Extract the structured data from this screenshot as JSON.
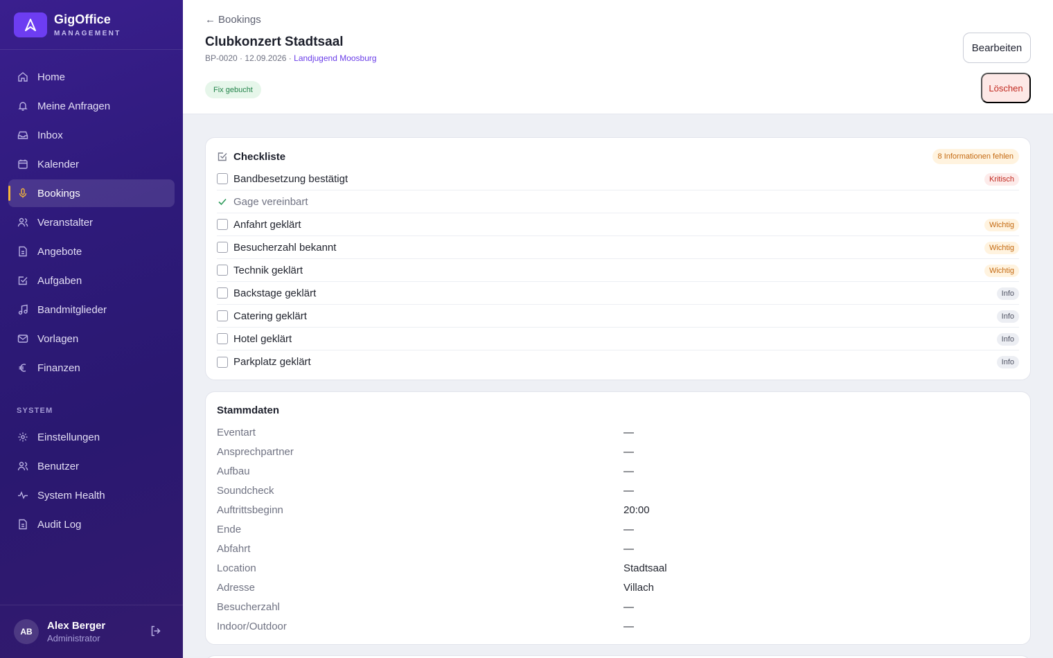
{
  "brand": {
    "name": "GigOffice",
    "subtitle": "MANAGEMENT"
  },
  "nav": {
    "items": [
      {
        "label": "Home",
        "icon": "home-icon",
        "active": false
      },
      {
        "label": "Meine Anfragen",
        "icon": "bell-icon",
        "active": false
      },
      {
        "label": "Inbox",
        "icon": "inbox-icon",
        "active": false
      },
      {
        "label": "Kalender",
        "icon": "calendar-icon",
        "active": false
      },
      {
        "label": "Bookings",
        "icon": "microphone-icon",
        "active": true
      },
      {
        "label": "Veranstalter",
        "icon": "users-icon",
        "active": false
      },
      {
        "label": "Angebote",
        "icon": "document-icon",
        "active": false
      },
      {
        "label": "Aufgaben",
        "icon": "checkbox-icon",
        "active": false
      },
      {
        "label": "Bandmitglieder",
        "icon": "music-note-icon",
        "active": false
      },
      {
        "label": "Vorlagen",
        "icon": "mail-icon",
        "active": false
      },
      {
        "label": "Finanzen",
        "icon": "euro-icon",
        "active": false
      }
    ],
    "section_label": "SYSTEM",
    "system_items": [
      {
        "label": "Einstellungen",
        "icon": "gear-icon"
      },
      {
        "label": "Benutzer",
        "icon": "users-icon"
      },
      {
        "label": "System Health",
        "icon": "activity-icon"
      },
      {
        "label": "Audit Log",
        "icon": "document-icon"
      }
    ]
  },
  "user": {
    "initials": "AB",
    "name": "Alex Berger",
    "role": "Administrator"
  },
  "header": {
    "back_label": "Bookings",
    "title": "Clubkonzert Stadtsaal",
    "booking_id": "BP-0020",
    "date": "12.09.2026",
    "organizer": "Landjugend Moosburg",
    "separator": "·",
    "status": "Fix gebucht",
    "edit_label": "Bearbeiten",
    "delete_label": "Löschen"
  },
  "checklist": {
    "title": "Checkliste",
    "missing_badge": "8 Informationen fehlen",
    "items": [
      {
        "label": "Bandbesetzung bestätigt",
        "done": false,
        "priority": "Kritisch",
        "level": "kritisch"
      },
      {
        "label": "Gage vereinbart",
        "done": true,
        "priority": "",
        "level": ""
      },
      {
        "label": "Anfahrt geklärt",
        "done": false,
        "priority": "Wichtig",
        "level": "wichtig"
      },
      {
        "label": "Besucherzahl bekannt",
        "done": false,
        "priority": "Wichtig",
        "level": "wichtig"
      },
      {
        "label": "Technik geklärt",
        "done": false,
        "priority": "Wichtig",
        "level": "wichtig"
      },
      {
        "label": "Backstage geklärt",
        "done": false,
        "priority": "Info",
        "level": "info"
      },
      {
        "label": "Catering geklärt",
        "done": false,
        "priority": "Info",
        "level": "info"
      },
      {
        "label": "Hotel geklärt",
        "done": false,
        "priority": "Info",
        "level": "info"
      },
      {
        "label": "Parkplatz geklärt",
        "done": false,
        "priority": "Info",
        "level": "info"
      }
    ]
  },
  "stammdaten": {
    "title": "Stammdaten",
    "fields": [
      {
        "label": "Eventart",
        "value": "—"
      },
      {
        "label": "Ansprechpartner",
        "value": "—"
      },
      {
        "label": "Aufbau",
        "value": "—"
      },
      {
        "label": "Soundcheck",
        "value": "—"
      },
      {
        "label": "Auftrittsbeginn",
        "value": "20:00"
      },
      {
        "label": "Ende",
        "value": "—"
      },
      {
        "label": "Abfahrt",
        "value": "—"
      },
      {
        "label": "Location",
        "value": "Stadtsaal"
      },
      {
        "label": "Adresse",
        "value": "Villach"
      },
      {
        "label": "Besucherzahl",
        "value": "—"
      },
      {
        "label": "Indoor/Outdoor",
        "value": "—"
      }
    ]
  },
  "colors": {
    "sidebar": "#2e1a7a",
    "accent": "#6d3df2",
    "active_indicator": "#f5b53b",
    "success": "#23834a",
    "danger": "#c0281e",
    "warning": "#c46a12"
  }
}
